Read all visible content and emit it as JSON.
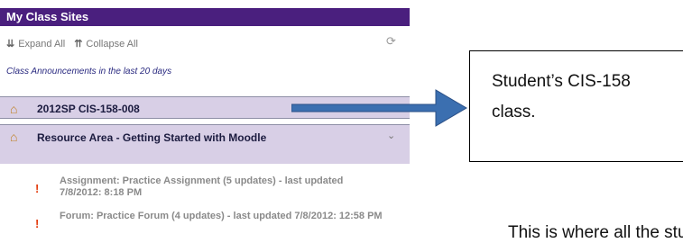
{
  "widget": {
    "title": "My Class Sites",
    "expand_icon": "double-chevron-down-icon",
    "expand_label": "Expand All",
    "collapse_icon": "double-chevron-up-icon",
    "collapse_label": "Collapse All",
    "refresh_icon": "refresh-icon",
    "announcements": "Class Announcements in the last 20 days"
  },
  "courses": [
    {
      "name": "2012SP CIS-158-008",
      "icon": "course-building-icon"
    },
    {
      "name": "Resource Area - Getting Started with Moodle",
      "icon": "course-building-icon",
      "expanded": true
    }
  ],
  "notices": [
    {
      "text": "Assignment: Practice Assignment (5 updates) - last updated 7/8/2012: 8:18 PM",
      "icon": "exclamation-icon"
    },
    {
      "text": "Forum: Practice Forum (4 updates) - last updated 7/8/2012: 12:58 PM",
      "icon": "exclamation-icon"
    }
  ],
  "callout": {
    "text": "Student’s CIS-158 class."
  },
  "bottom_text": "This is where all the stude",
  "colors": {
    "title_bar": "#4a1f7e",
    "course_row": "#d8cfe6",
    "arrow": "#3b6fb0",
    "alert": "#e33c0e"
  }
}
